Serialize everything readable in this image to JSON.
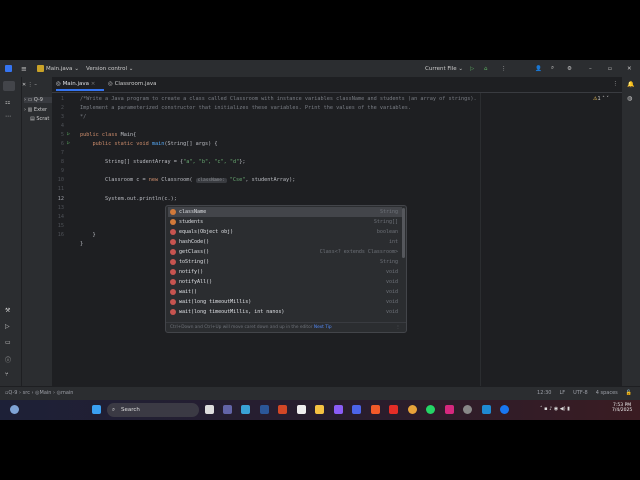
{
  "titlebar": {
    "project": "Main.java",
    "vcs": "Version control",
    "run_config": "Current File"
  },
  "tabs": [
    {
      "label": "Main.java",
      "active": true
    },
    {
      "label": "Classroom.java"
    }
  ],
  "project_tree": [
    "Q-9",
    "Exter",
    "Scrat"
  ],
  "editor": {
    "lines": [
      "1",
      "2",
      "3",
      "4",
      "5",
      "6",
      "7",
      "8",
      "9",
      "10",
      "11",
      "12",
      "13",
      "14",
      "15",
      "16"
    ],
    "code": {
      "l1": "/*Write a Java program to create a class called Classroom with instance variables className and students (an array of strings).",
      "l2": "Implement a parameterized constructor that initializes these variables. Print the values of the variables.",
      "l3": "*/",
      "l5a": "public class ",
      "l5b": "Main{",
      "l6a": "    public static void ",
      "l6b": "main",
      "l6c": "(String[] args) {",
      "l8a": "        String[] studentArray = {",
      "l8b": "\"a\", \"b\", \"c\", \"d\"",
      "l8c": "};",
      "l10a": "        Classroom c = ",
      "l10b": "new ",
      "l10c": "Classroom( ",
      "l10hint": "className:",
      "l10d": " \"Cse\"",
      "l10e": ", studentArray);",
      "l12": "        System.out.println(c.);",
      "l14": "    }",
      "l15": "}"
    },
    "warnings": "1"
  },
  "completion": {
    "items": [
      {
        "name": "className",
        "type": "String",
        "kind": "field"
      },
      {
        "name": "students",
        "type": "String[]",
        "kind": "field"
      },
      {
        "name": "equals(Object obj)",
        "type": "boolean",
        "kind": "method"
      },
      {
        "name": "hashCode()",
        "type": "int",
        "kind": "method"
      },
      {
        "name": "getClass()",
        "type": "Class<? extends Classroom>",
        "kind": "method"
      },
      {
        "name": "toString()",
        "type": "String",
        "kind": "method"
      },
      {
        "name": "notify()",
        "type": "void",
        "kind": "method"
      },
      {
        "name": "notifyAll()",
        "type": "void",
        "kind": "method"
      },
      {
        "name": "wait()",
        "type": "void",
        "kind": "method"
      },
      {
        "name": "wait(long timeoutMillis)",
        "type": "void",
        "kind": "method"
      },
      {
        "name": "wait(long timeoutMillis, int nanos)",
        "type": "void",
        "kind": "method"
      }
    ],
    "tip": "Ctrl+Down and Ctrl+Up will move caret down and up in the editor",
    "next_tip": "Next Tip"
  },
  "statusbar": {
    "breadcrumb": [
      "Q-9",
      "src",
      "Main",
      "main"
    ],
    "position": "12:30",
    "line_sep": "LF",
    "encoding": "UTF-8",
    "indent": "4 spaces"
  },
  "taskbar": {
    "search": "Search",
    "time": "7:53 PM",
    "date": "7/4/2025"
  }
}
